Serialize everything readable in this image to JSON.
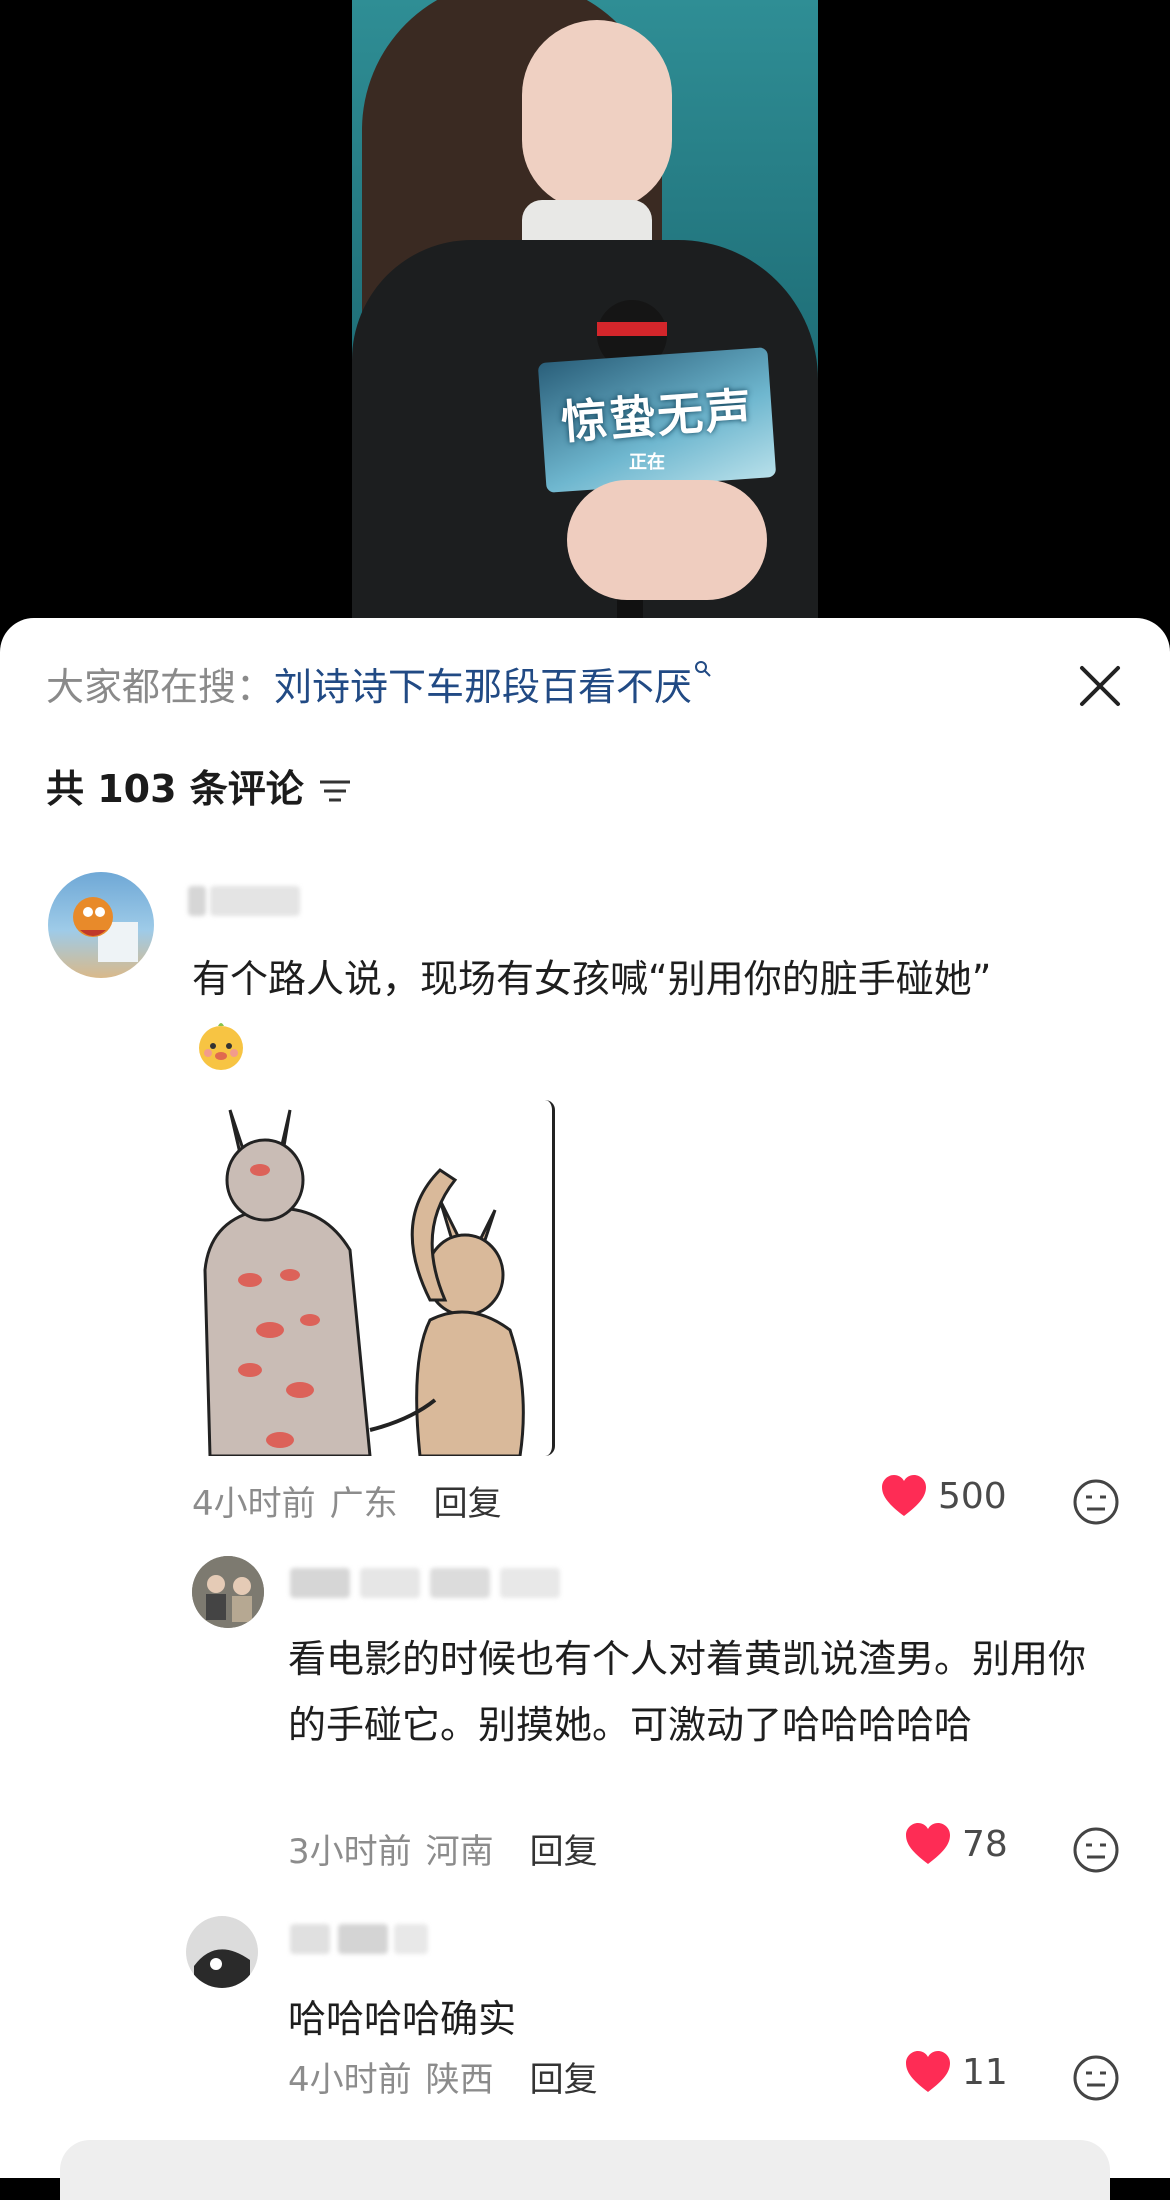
{
  "search": {
    "prefix": "大家都在搜：",
    "query": "刘诗诗下车那段百看不厌",
    "search_icon": "magnifier-icon"
  },
  "header": {
    "comment_count": "共 103 条评论"
  },
  "video": {
    "sign_text": "惊蛰无声",
    "sign_sub": "正在"
  },
  "comments": [
    {
      "username": "…em",
      "text": "有个路人说，现场有女孩喊“别用你的脏手碰她”",
      "emoji": "cute-face-emoji",
      "time": "4小时前",
      "location": "广东",
      "reply_label": "回复",
      "likes": "500",
      "sticker": "two-animal-meme-sticker"
    },
    {
      "username": "…ing",
      "text": "看电影的时候也有个人对着黄凯说渣男。别用你的手碰它。别摸她。可激动了哈哈哈哈哈",
      "time": "3小时前",
      "location": "河南",
      "reply_label": "回复",
      "likes": "78"
    },
    {
      "username": "",
      "text": "哈哈哈哈确实",
      "time": "4小时前",
      "location": "陕西",
      "reply_label": "回复",
      "likes": "11"
    }
  ],
  "colors": {
    "heart": "#fe2c55",
    "search_link": "#214a84",
    "meta": "#8c8c8c"
  }
}
